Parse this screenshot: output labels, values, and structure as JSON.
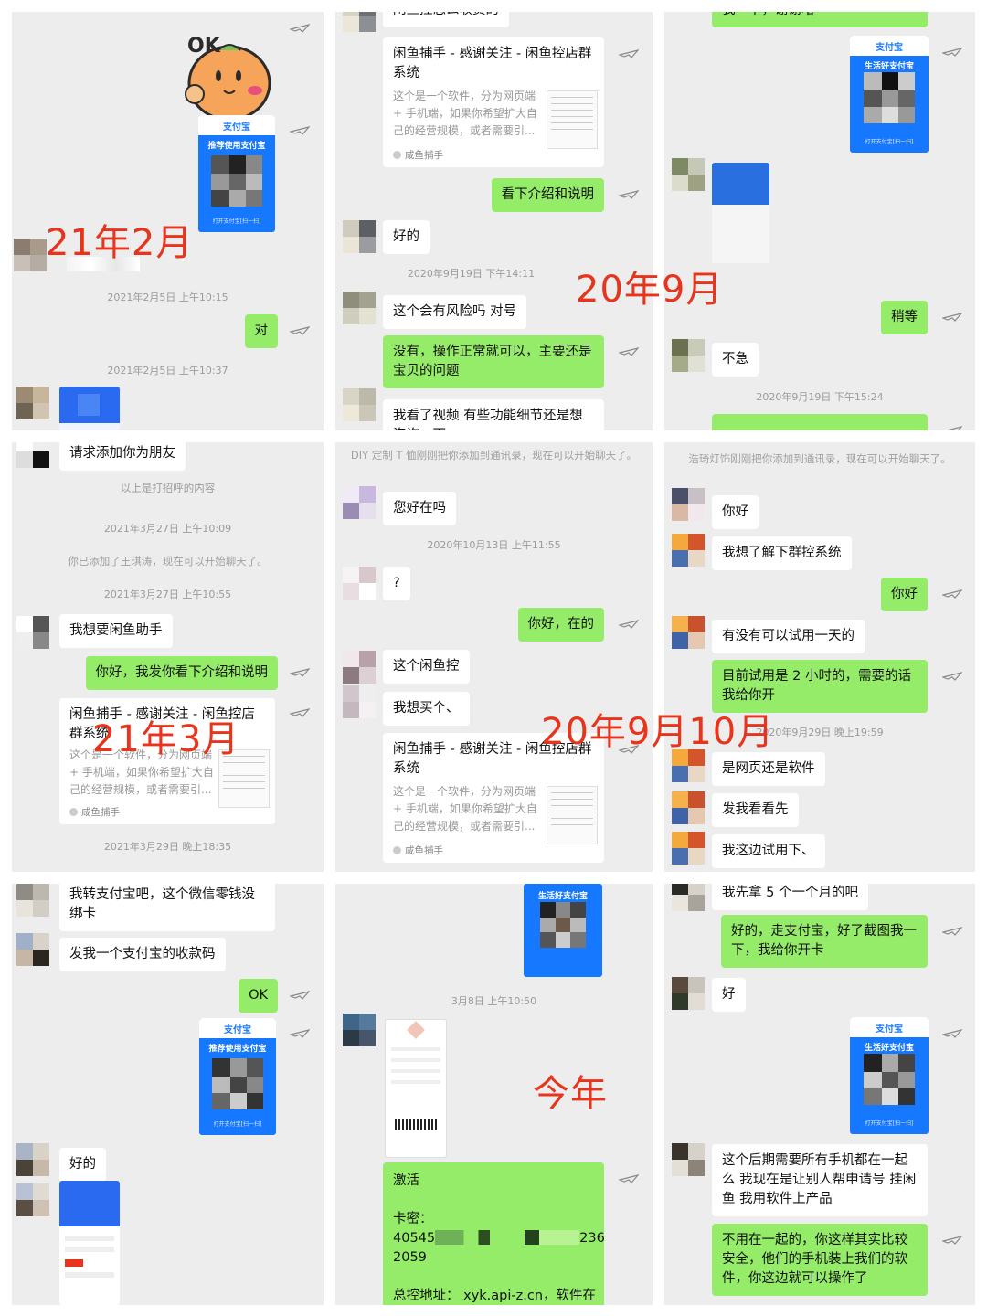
{
  "labels": {
    "feb21": "21年2月",
    "sep20": "20年9月",
    "mar21": "21年3月",
    "sep10": "20年9月10月",
    "this_year": "今年"
  },
  "colors": {
    "bubble_self": "#95ec69",
    "bubble_other": "#ffffff",
    "panel_bg": "#ededed",
    "label_red": "#e8341c",
    "alipay_blue": "#1677ff"
  },
  "p1": {
    "ts1": "2021年2月5日 上午10:15",
    "ts2": "2021年2月5日 上午10:37",
    "msg_dui": "对",
    "alipay_title": "支付宝",
    "alipay_banner": "推荐使用支付宝",
    "alipay_foot": "打开支付宝[扫一扫]"
  },
  "p2": {
    "top_cut": "闲鱼控怎么收费的",
    "card_title": "闲鱼捕手 - 感谢关注 - 闲鱼控店群系统",
    "card_desc": "这个是一个软件，分为网页端 + 手机端，如果你希望扩大自己的经营规模，或者需要引...",
    "card_src": "咸鱼捕手",
    "msg1": "看下介绍和说明",
    "msg2": "好的",
    "ts1": "2020年9月19日 下午14:11",
    "msg3": "这个会有风险吗 对号",
    "msg4": "没有，操作正常就可以，主要还是宝贝的问题",
    "msg5": "我看了视频 有些功能细节还是想咨询一下"
  },
  "p3": {
    "top_cut": "我一下，谢谢哈",
    "alipay_title": "支付宝",
    "alipay_banner": "生活好支付宝",
    "alipay_foot": "打开支付宝[扫一扫]",
    "msg1": "稍等",
    "msg2": "不急",
    "ts1": "2020年9月19日 下午15:24"
  },
  "p4": {
    "msg1": "请求添加你为朋友",
    "sys1": "以上是打招呼的内容",
    "ts1": "2021年3月27日 上午10:09",
    "sys2": "你已添加了王琪涛，现在可以开始聊天了。",
    "ts2": "2021年3月27日 上午10:55",
    "msg2": "我想要闲鱼助手",
    "msg3": "你好，我发你看下介绍和说明",
    "card_title": "闲鱼捕手 - 感谢关注 - 闲鱼控店群系统",
    "card_desc": "这个是一个软件，分为网页端 + 手机端，如果你希望扩大自己的经营规模，或者需要引...",
    "card_src": "咸鱼捕手",
    "ts3": "2021年3月29日 晚上18:35"
  },
  "p5": {
    "sys1": "DIY 定制 T 恤刚刚把你添加到通讯录，现在可以开始聊天了。",
    "msg1": "您好在吗",
    "ts1": "2020年10月13日 上午11:55",
    "msg2": "?",
    "msg3": "你好，在的",
    "msg4": "这个闲鱼控",
    "msg5": "我想买个、",
    "card_title": "闲鱼捕手 - 感谢关注 - 闲鱼控店群系统",
    "card_desc": "这个是一个软件，分为网页端 + 手机端，如果你希望扩大自己的经营规模，或者需要引...",
    "card_src": "咸鱼捕手"
  },
  "p6": {
    "sys1": "浩琦灯饰刚刚把你添加到通讯录，现在可以开始聊天了。",
    "msg1": "你好",
    "msg2": "我想了解下群控系统",
    "msg3": "你好",
    "msg4": "有没有可以试用一天的",
    "msg5": "目前试用是 2 小时的，需要的话我给你开",
    "ts1": "2020年9月29日 晚上19:59",
    "msg6": "是网页还是软件",
    "msg7": "发我看看先",
    "msg8": "我这边试用下、"
  },
  "p7": {
    "msg1": "我转支付宝吧，这个微信零钱没绑卡",
    "msg2": "发我一个支付宝的收款码",
    "msg3": "OK",
    "alipay_title": "支付宝",
    "alipay_banner": "推荐使用支付宝",
    "alipay_foot": "打开支付宝[扫一扫]",
    "msg4": "好的"
  },
  "p8": {
    "alipay_banner": "生活好支付宝",
    "ts1": "3月8日 上午10:50",
    "msg1_l1": "激活",
    "msg1_l2": "卡密：",
    "msg1_l3a": "40545",
    "msg1_l3b": "236",
    "msg1_l4": "2059",
    "msg1_l5": "总控地址：  xyk.api-z.cn，软件在"
  },
  "p9": {
    "msg1": "我先拿 5 个一个月的吧",
    "msg2": "好的，走支付宝，好了截图我一下，我给你开卡",
    "msg3": "好",
    "alipay_title": "支付宝",
    "alipay_banner": "生活好支付宝",
    "alipay_foot": "打开支付宝[扫一扫]",
    "msg4": "这个后期需要所有手机都在一起么 我现在是让别人帮申请号 挂闲鱼 我用软件上产品",
    "msg5": "不用在一起的，你这样其实比较安全，他们的手机装上我们的软件，你这边就可以操作了"
  }
}
